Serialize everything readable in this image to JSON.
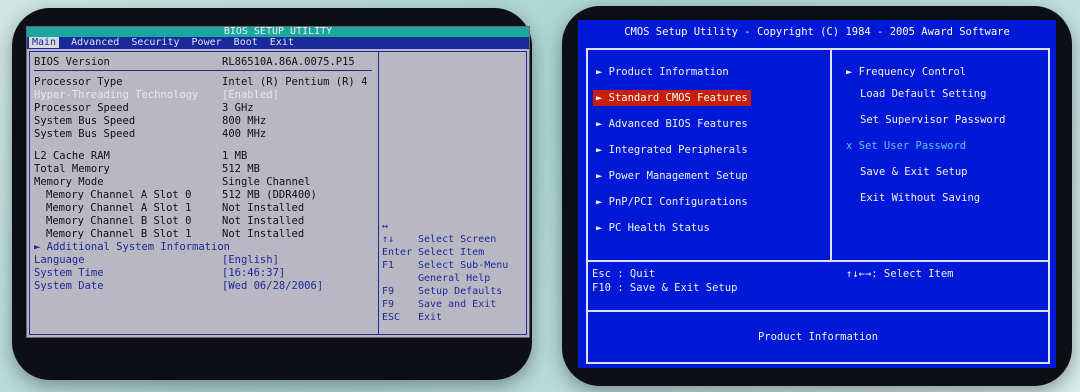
{
  "left_bios": {
    "title": "BIOS SETUP UTILITY",
    "menu": [
      "Main",
      "Advanced",
      "Security",
      "Power",
      "Boot",
      "Exit"
    ],
    "rows": [
      {
        "label": "BIOS Version",
        "value": "RL86510A.86A.0075.P15"
      },
      {
        "label": "Processor Type",
        "value": "Intel (R) Pentium (R) 4"
      },
      {
        "label": "Hyper-Threading Technology",
        "value": "[Enabled]"
      },
      {
        "label": "Processor Speed",
        "value": "3 GHz"
      },
      {
        "label": "System Bus Speed",
        "value": "800 MHz"
      },
      {
        "label": "System Bus Speed",
        "value": "400 MHz"
      },
      {
        "label": "L2 Cache RAM",
        "value": "1 MB"
      },
      {
        "label": "Total Memory",
        "value": "512 MB"
      },
      {
        "label": "Memory Mode",
        "value": "Single Channel"
      },
      {
        "label": "Memory Channel A Slot 0",
        "value": "512 MB (DDR400)"
      },
      {
        "label": "Memory Channel A Slot 1",
        "value": "Not Installed"
      },
      {
        "label": "Memory Channel B Slot 0",
        "value": "Not Installed"
      },
      {
        "label": "Memory Channel B Slot 1",
        "value": "Not Installed"
      },
      {
        "label": "► Additional System Information",
        "value": ""
      },
      {
        "label": "Language",
        "value": "[English]"
      },
      {
        "label": "System Time",
        "value": "[16:46:37]"
      },
      {
        "label": "System Date",
        "value": "[Wed 06/28/2006]"
      }
    ],
    "help": [
      {
        "key": "↔",
        "desc": ""
      },
      {
        "key": "↑↓",
        "desc": "Select Screen"
      },
      {
        "key": "Enter",
        "desc": "Select Item"
      },
      {
        "key": "F1",
        "desc": "Select Sub-Menu"
      },
      {
        "key": "",
        "desc": "General Help"
      },
      {
        "key": "F9",
        "desc": "Setup Defaults"
      },
      {
        "key": "F9",
        "desc": "Save and Exit"
      },
      {
        "key": "ESC",
        "desc": "Exit"
      }
    ]
  },
  "right_cmos": {
    "title": "CMOS Setup Utility - Copyright (C) 1984 - 2005 Award Software",
    "left_items": [
      "► Product Information",
      "► Standard CMOS Features",
      "► Advanced BIOS Features",
      "► Integrated Peripherals",
      "► Power Management Setup",
      "► PnP/PCI Configurations",
      "► PC Health Status"
    ],
    "right_items": [
      "► Frequency Control",
      "Load Default Setting",
      "Set Supervisor Password",
      "x Set User Password",
      "Save & Exit Setup",
      "Exit Without Saving"
    ],
    "status_esc": "Esc : Quit",
    "status_f10": "F10 : Save & Exit Setup",
    "status_select": "↑↓←→: Select Item",
    "info": "Product Information"
  },
  "colors": {
    "award_blue": "#0018d8",
    "award_highlight": "#c81e0a",
    "intel_blue": "#1b2a9a",
    "intel_teal": "#1aa7a0"
  }
}
